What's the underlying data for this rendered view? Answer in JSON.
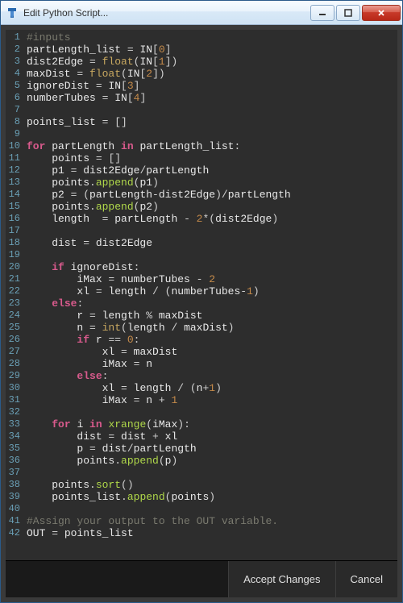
{
  "window": {
    "title": "Edit Python Script..."
  },
  "footer": {
    "accept": "Accept Changes",
    "cancel": "Cancel"
  },
  "code": {
    "lines": [
      {
        "n": 1,
        "tokens": [
          [
            "comment",
            "#inputs"
          ]
        ]
      },
      {
        "n": 2,
        "tokens": [
          [
            "ident",
            "partLength_list "
          ],
          [
            "op",
            "= "
          ],
          [
            "ident",
            "IN"
          ],
          [
            "paren",
            "["
          ],
          [
            "num",
            "0"
          ],
          [
            "paren",
            "]"
          ]
        ]
      },
      {
        "n": 3,
        "tokens": [
          [
            "ident",
            "dist2Edge "
          ],
          [
            "op",
            "= "
          ],
          [
            "type",
            "float"
          ],
          [
            "paren",
            "("
          ],
          [
            "ident",
            "IN"
          ],
          [
            "paren",
            "["
          ],
          [
            "num",
            "1"
          ],
          [
            "paren",
            "])"
          ]
        ]
      },
      {
        "n": 4,
        "tokens": [
          [
            "ident",
            "maxDist "
          ],
          [
            "op",
            "= "
          ],
          [
            "type",
            "float"
          ],
          [
            "paren",
            "("
          ],
          [
            "ident",
            "IN"
          ],
          [
            "paren",
            "["
          ],
          [
            "num",
            "2"
          ],
          [
            "paren",
            "])"
          ]
        ]
      },
      {
        "n": 5,
        "tokens": [
          [
            "ident",
            "ignoreDist "
          ],
          [
            "op",
            "= "
          ],
          [
            "ident",
            "IN"
          ],
          [
            "paren",
            "["
          ],
          [
            "num",
            "3"
          ],
          [
            "paren",
            "]"
          ]
        ]
      },
      {
        "n": 6,
        "tokens": [
          [
            "ident",
            "numberTubes "
          ],
          [
            "op",
            "= "
          ],
          [
            "ident",
            "IN"
          ],
          [
            "paren",
            "["
          ],
          [
            "num",
            "4"
          ],
          [
            "paren",
            "]"
          ]
        ]
      },
      {
        "n": 7,
        "tokens": []
      },
      {
        "n": 8,
        "tokens": [
          [
            "ident",
            "points_list "
          ],
          [
            "op",
            "= "
          ],
          [
            "paren",
            "[]"
          ]
        ]
      },
      {
        "n": 9,
        "tokens": []
      },
      {
        "n": 10,
        "tokens": [
          [
            "kw",
            "for "
          ],
          [
            "ident",
            "partLength "
          ],
          [
            "kw",
            "in "
          ],
          [
            "ident",
            "partLength_list"
          ],
          [
            "op",
            ":"
          ]
        ]
      },
      {
        "n": 11,
        "tokens": [
          [
            "ident",
            "    points "
          ],
          [
            "op",
            "= "
          ],
          [
            "paren",
            "[]"
          ]
        ]
      },
      {
        "n": 12,
        "tokens": [
          [
            "ident",
            "    p1 "
          ],
          [
            "op",
            "= "
          ],
          [
            "ident",
            "dist2Edge"
          ],
          [
            "op",
            "/"
          ],
          [
            "ident",
            "partLength"
          ]
        ]
      },
      {
        "n": 13,
        "tokens": [
          [
            "ident",
            "    points"
          ],
          [
            "op",
            "."
          ],
          [
            "func",
            "append"
          ],
          [
            "paren",
            "("
          ],
          [
            "ident",
            "p1"
          ],
          [
            "paren",
            ")"
          ]
        ]
      },
      {
        "n": 14,
        "tokens": [
          [
            "ident",
            "    p2 "
          ],
          [
            "op",
            "= "
          ],
          [
            "paren",
            "("
          ],
          [
            "ident",
            "partLength"
          ],
          [
            "op",
            "-"
          ],
          [
            "ident",
            "dist2Edge"
          ],
          [
            "paren",
            ")"
          ],
          [
            "op",
            "/"
          ],
          [
            "ident",
            "partLength"
          ]
        ]
      },
      {
        "n": 15,
        "tokens": [
          [
            "ident",
            "    points"
          ],
          [
            "op",
            "."
          ],
          [
            "func",
            "append"
          ],
          [
            "paren",
            "("
          ],
          [
            "ident",
            "p2"
          ],
          [
            "paren",
            ")"
          ]
        ]
      },
      {
        "n": 16,
        "tokens": [
          [
            "ident",
            "    length  "
          ],
          [
            "op",
            "= "
          ],
          [
            "ident",
            "partLength "
          ],
          [
            "op",
            "- "
          ],
          [
            "num",
            "2"
          ],
          [
            "op",
            "*"
          ],
          [
            "paren",
            "("
          ],
          [
            "ident",
            "dist2Edge"
          ],
          [
            "paren",
            ")"
          ]
        ]
      },
      {
        "n": 17,
        "tokens": []
      },
      {
        "n": 18,
        "tokens": [
          [
            "ident",
            "    dist "
          ],
          [
            "op",
            "= "
          ],
          [
            "ident",
            "dist2Edge"
          ]
        ]
      },
      {
        "n": 19,
        "tokens": []
      },
      {
        "n": 20,
        "tokens": [
          [
            "ident",
            "    "
          ],
          [
            "kw",
            "if "
          ],
          [
            "ident",
            "ignoreDist"
          ],
          [
            "op",
            ":"
          ]
        ]
      },
      {
        "n": 21,
        "tokens": [
          [
            "ident",
            "        iMax "
          ],
          [
            "op",
            "= "
          ],
          [
            "ident",
            "numberTubes "
          ],
          [
            "op",
            "- "
          ],
          [
            "num",
            "2"
          ]
        ]
      },
      {
        "n": 22,
        "tokens": [
          [
            "ident",
            "        xl "
          ],
          [
            "op",
            "= "
          ],
          [
            "ident",
            "length "
          ],
          [
            "op",
            "/ "
          ],
          [
            "paren",
            "("
          ],
          [
            "ident",
            "numberTubes"
          ],
          [
            "op",
            "-"
          ],
          [
            "num",
            "1"
          ],
          [
            "paren",
            ")"
          ]
        ]
      },
      {
        "n": 23,
        "tokens": [
          [
            "ident",
            "    "
          ],
          [
            "kw",
            "else"
          ],
          [
            "op",
            ":"
          ]
        ]
      },
      {
        "n": 24,
        "tokens": [
          [
            "ident",
            "        r "
          ],
          [
            "op",
            "= "
          ],
          [
            "ident",
            "length "
          ],
          [
            "op",
            "% "
          ],
          [
            "ident",
            "maxDist"
          ]
        ]
      },
      {
        "n": 25,
        "tokens": [
          [
            "ident",
            "        n "
          ],
          [
            "op",
            "= "
          ],
          [
            "type",
            "int"
          ],
          [
            "paren",
            "("
          ],
          [
            "ident",
            "length "
          ],
          [
            "op",
            "/ "
          ],
          [
            "ident",
            "maxDist"
          ],
          [
            "paren",
            ")"
          ]
        ]
      },
      {
        "n": 26,
        "tokens": [
          [
            "ident",
            "        "
          ],
          [
            "kw",
            "if "
          ],
          [
            "ident",
            "r "
          ],
          [
            "op",
            "== "
          ],
          [
            "num",
            "0"
          ],
          [
            "op",
            ":"
          ]
        ]
      },
      {
        "n": 27,
        "tokens": [
          [
            "ident",
            "            xl "
          ],
          [
            "op",
            "= "
          ],
          [
            "ident",
            "maxDist"
          ]
        ]
      },
      {
        "n": 28,
        "tokens": [
          [
            "ident",
            "            iMax "
          ],
          [
            "op",
            "= "
          ],
          [
            "ident",
            "n"
          ]
        ]
      },
      {
        "n": 29,
        "tokens": [
          [
            "ident",
            "        "
          ],
          [
            "kw",
            "else"
          ],
          [
            "op",
            ":"
          ]
        ]
      },
      {
        "n": 30,
        "tokens": [
          [
            "ident",
            "            xl "
          ],
          [
            "op",
            "= "
          ],
          [
            "ident",
            "length "
          ],
          [
            "op",
            "/ "
          ],
          [
            "paren",
            "("
          ],
          [
            "ident",
            "n"
          ],
          [
            "op",
            "+"
          ],
          [
            "num",
            "1"
          ],
          [
            "paren",
            ")"
          ]
        ]
      },
      {
        "n": 31,
        "tokens": [
          [
            "ident",
            "            iMax "
          ],
          [
            "op",
            "= "
          ],
          [
            "ident",
            "n "
          ],
          [
            "op",
            "+ "
          ],
          [
            "num",
            "1"
          ]
        ]
      },
      {
        "n": 32,
        "tokens": []
      },
      {
        "n": 33,
        "tokens": [
          [
            "ident",
            "    "
          ],
          [
            "kw",
            "for "
          ],
          [
            "ident",
            "i "
          ],
          [
            "kw",
            "in "
          ],
          [
            "func",
            "xrange"
          ],
          [
            "paren",
            "("
          ],
          [
            "ident",
            "iMax"
          ],
          [
            "paren",
            ")"
          ],
          [
            "op",
            ":"
          ]
        ]
      },
      {
        "n": 34,
        "tokens": [
          [
            "ident",
            "        dist "
          ],
          [
            "op",
            "= "
          ],
          [
            "ident",
            "dist "
          ],
          [
            "op",
            "+ "
          ],
          [
            "ident",
            "xl"
          ]
        ]
      },
      {
        "n": 35,
        "tokens": [
          [
            "ident",
            "        p "
          ],
          [
            "op",
            "= "
          ],
          [
            "ident",
            "dist"
          ],
          [
            "op",
            "/"
          ],
          [
            "ident",
            "partLength"
          ]
        ]
      },
      {
        "n": 36,
        "tokens": [
          [
            "ident",
            "        points"
          ],
          [
            "op",
            "."
          ],
          [
            "func",
            "append"
          ],
          [
            "paren",
            "("
          ],
          [
            "ident",
            "p"
          ],
          [
            "paren",
            ")"
          ]
        ]
      },
      {
        "n": 37,
        "tokens": []
      },
      {
        "n": 38,
        "tokens": [
          [
            "ident",
            "    points"
          ],
          [
            "op",
            "."
          ],
          [
            "func",
            "sort"
          ],
          [
            "paren",
            "()"
          ]
        ]
      },
      {
        "n": 39,
        "tokens": [
          [
            "ident",
            "    points_list"
          ],
          [
            "op",
            "."
          ],
          [
            "func",
            "append"
          ],
          [
            "paren",
            "("
          ],
          [
            "ident",
            "points"
          ],
          [
            "paren",
            ")"
          ]
        ]
      },
      {
        "n": 40,
        "tokens": []
      },
      {
        "n": 41,
        "tokens": [
          [
            "comment",
            "#Assign your output to the OUT variable."
          ]
        ]
      },
      {
        "n": 42,
        "tokens": [
          [
            "ident",
            "OUT "
          ],
          [
            "op",
            "= "
          ],
          [
            "ident",
            "points_list"
          ]
        ]
      }
    ]
  }
}
